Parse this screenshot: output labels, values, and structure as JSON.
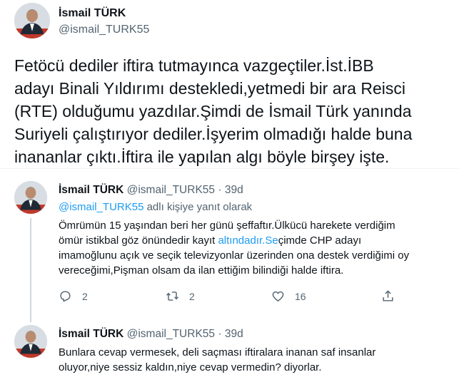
{
  "main_tweet": {
    "author_name": "İsmail TÜRK",
    "handle": "@ismail_TURK55",
    "text_lines": [
      "Fetöcü dediler iftira tutmayınca vazgeçtiler.İst.İBB",
      "adayı Binali Yıldırımı destekledi,yetmedi bir ara Reisci",
      "(RTE) olduğumu yazdılar.Şimdi de İsmail Türk yanında",
      "Suriyeli çalıştırıyor dediler.İşyerim olmadığı halde buna",
      "inananlar çıktı.İftira ile yapılan algı böyle birşey işte."
    ]
  },
  "reply_1": {
    "author_name": "İsmail TÜRK",
    "handle": "@ismail_TURK55",
    "separator": "·",
    "time": "39d",
    "replying_mention": "@ismail_TURK55",
    "replying_suffix": "adlı kişiye yanıt olarak",
    "line1": "Ömrümün 15 yaşından beri her günü şeffaftır.Ülkücü harekete verdiğim",
    "line2_prefix": "ömür istikbal göz önündedir kayıt ",
    "line2_link": "altındadır.Se",
    "line2_suffix": "çimde CHP adayı",
    "line3": "imamoğlunu açık ve seçik televizyonlar üzerinden ona destek verdiğimi oy",
    "line4": "vereceğimi,Pişman olsam da ilan ettiğim bilindiği halde iftira.",
    "actions": {
      "reply_count": "2",
      "retweet_count": "2",
      "like_count": "16"
    }
  },
  "reply_2": {
    "author_name": "İsmail TÜRK",
    "handle": "@ismail_TURK55",
    "separator": "·",
    "time": "39d",
    "text_lines": [
      "Bunlara cevap vermesek, deli saçması iftiralara inanan saf insanlar",
      "oluyor,niye sessiz kaldın,niye cevap vermedin? diyorlar."
    ]
  },
  "icons": {
    "reply": "reply-icon",
    "retweet": "retweet-icon",
    "like": "heart-icon",
    "share": "share-icon"
  },
  "colors": {
    "text": "#0f1419",
    "secondary": "#536471",
    "link": "#1d9bf0"
  }
}
